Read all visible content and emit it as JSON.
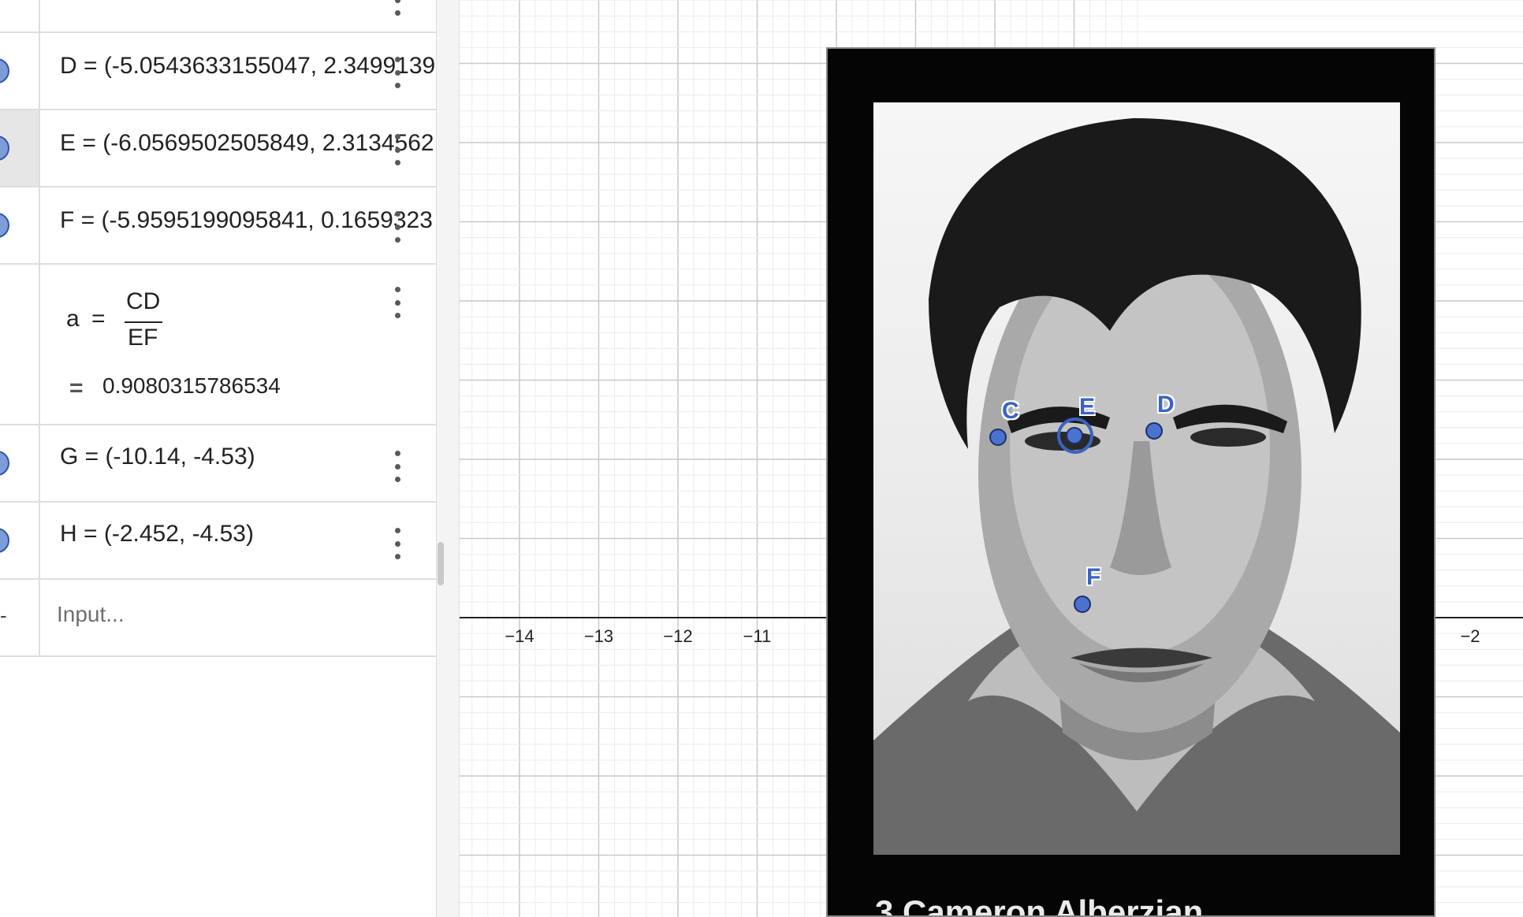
{
  "algebra": {
    "rows": [
      {
        "id": "row-D",
        "text": "D = (-5.0543633155047, 2.3499139"
      },
      {
        "id": "row-E",
        "text": "E = (-6.0569502505849, 2.3134562"
      },
      {
        "id": "row-F",
        "text": "F = (-5.9595199095841, 0.1659323"
      },
      {
        "id": "row-a",
        "lhs": "a",
        "eq": "=",
        "num": "CD",
        "den": "EF",
        "value_eq": "=",
        "value": "0.9080315786534"
      },
      {
        "id": "row-G",
        "text": "G = (-10.14, -4.53)"
      },
      {
        "id": "row-H",
        "text": "H = (-2.452, -4.53)"
      }
    ],
    "input_placeholder": "Input...",
    "input_marker": "-"
  },
  "graphics": {
    "x_ticks": [
      "−14",
      "−13",
      "−12",
      "−11",
      "−2"
    ],
    "points": [
      {
        "name": "C"
      },
      {
        "name": "E"
      },
      {
        "name": "D"
      },
      {
        "name": "F"
      }
    ],
    "caption": "3     Cameron Alberzian",
    "colors": {
      "point": "#3a63c4",
      "grid_major": "#c9c9c9",
      "grid_minor": "#ececec",
      "axis": "#222222"
    }
  }
}
